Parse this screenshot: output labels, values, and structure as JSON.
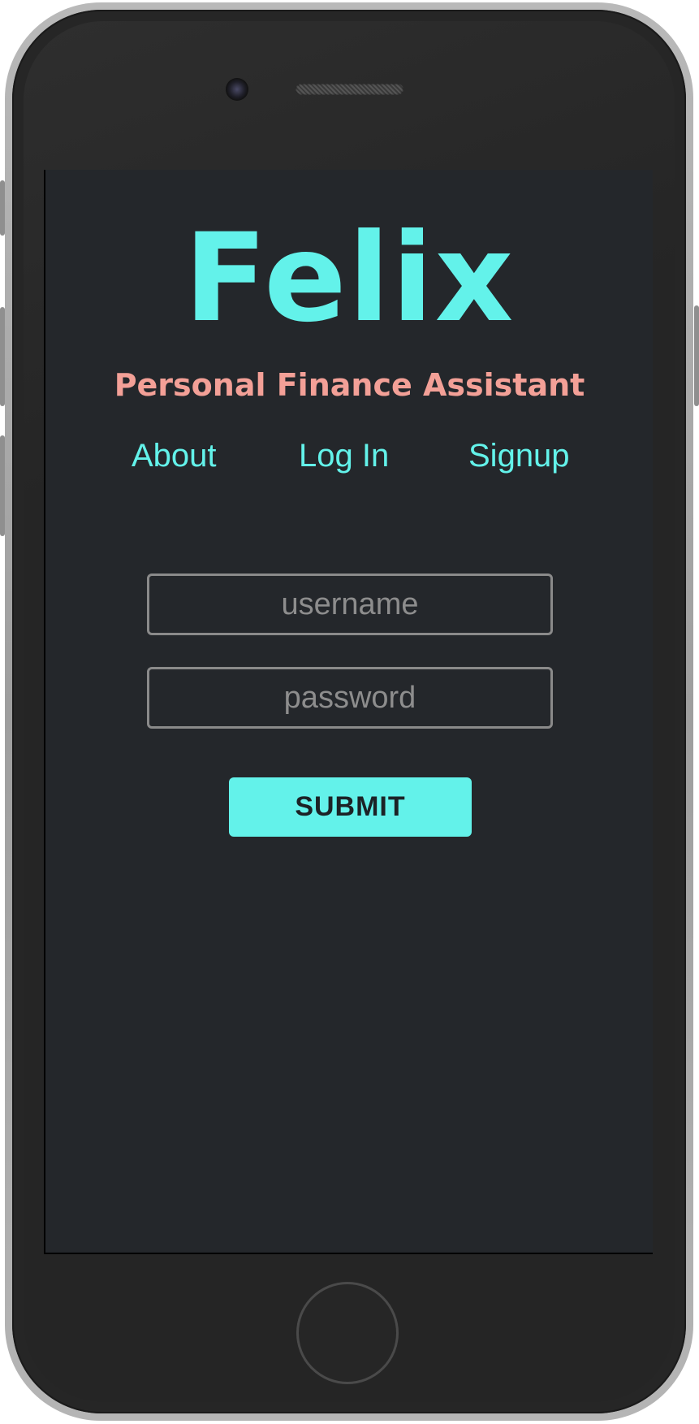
{
  "app": {
    "logo_text": "Felix",
    "tagline": "Personal Finance Assistant"
  },
  "nav": {
    "items": [
      {
        "label": "About"
      },
      {
        "label": "Log In"
      },
      {
        "label": "Signup"
      }
    ]
  },
  "form": {
    "username": {
      "value": "",
      "placeholder": "username"
    },
    "password": {
      "value": "",
      "placeholder": "password"
    },
    "submit_label": "SUBMIT"
  },
  "colors": {
    "accent": "#63f2ea",
    "tagline": "#f3a097",
    "screen_bg": "#24272b",
    "device_body": "#262626",
    "device_frame": "#a8a8a8"
  },
  "icons": {
    "camera": "front-camera-icon",
    "speaker": "earpiece-speaker-icon",
    "home": "home-button-icon"
  }
}
